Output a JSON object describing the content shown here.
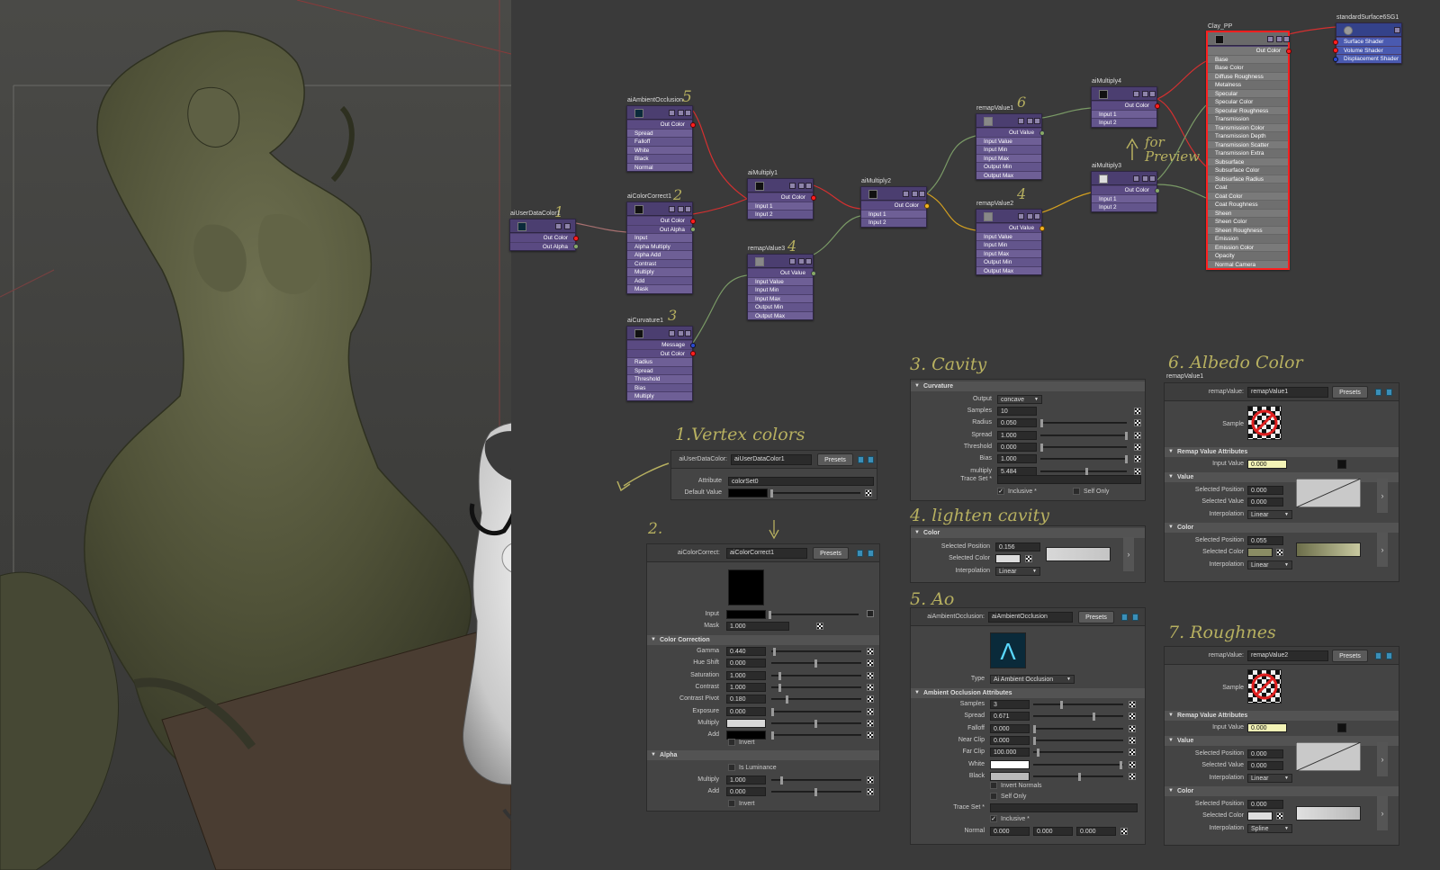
{
  "nodes": {
    "ao": {
      "title": "aiAmbientOcclusion",
      "out": "Out Color",
      "inputs": [
        "Spread",
        "Falloff",
        "White",
        "Black",
        "Normal"
      ]
    },
    "ud": {
      "title": "aiUserDataColor1",
      "outs": [
        "Out Color",
        "Out Alpha"
      ]
    },
    "cc": {
      "title": "aiColorCorrect1",
      "outs": [
        "Out Color",
        "Out Alpha"
      ],
      "inputs": [
        "Input",
        "Alpha Multiply",
        "Alpha Add",
        "Contrast",
        "Multiply",
        "Add",
        "Mask"
      ]
    },
    "curv": {
      "title": "aiCurvature1",
      "outs": [
        "Message",
        "Out Color"
      ],
      "inputs": [
        "Radius",
        "Spread",
        "Threshold",
        "Bias",
        "Multiply"
      ]
    },
    "m1": {
      "title": "aiMultiply1",
      "out": "Out Color",
      "inputs": [
        "Input 1",
        "Input 2"
      ]
    },
    "rv3": {
      "title": "remapValue3",
      "out": "Out Value",
      "inputs": [
        "Input Value",
        "Input Min",
        "Input Max",
        "Output Min",
        "Output Max"
      ]
    },
    "m2": {
      "title": "aiMultiply2",
      "out": "Out Color",
      "inputs": [
        "Input 1",
        "Input 2"
      ]
    },
    "rv1": {
      "title": "remapValue1",
      "out": "Out Value",
      "inputs": [
        "Input Value",
        "Input Min",
        "Input Max",
        "Output Min",
        "Output Max"
      ]
    },
    "rv2": {
      "title": "remapValue2",
      "out": "Out Value",
      "inputs": [
        "Input Value",
        "Input Min",
        "Input Max",
        "Output Min",
        "Output Max"
      ]
    },
    "m4": {
      "title": "aiMultiply4",
      "out": "Out Color",
      "inputs": [
        "Input 1",
        "Input 2"
      ]
    },
    "m3": {
      "title": "aiMultiply3",
      "out": "Out Color",
      "inputs": [
        "Input 1",
        "Input 2"
      ]
    },
    "clay": {
      "title": "Clay_PP",
      "out": "Out Color",
      "inputs": [
        "Base",
        "Base Color",
        "Diffuse Roughness",
        "Metalness",
        "Specular",
        "Specular Color",
        "Specular Roughness",
        "Transmission",
        "Transmission Color",
        "Transmission Depth",
        "Transmission Scatter",
        "Transmission Extra Roughness",
        "Subsurface",
        "Subsurface Color",
        "Subsurface Radius",
        "Coat",
        "Coat Color",
        "Coat Roughness",
        "Sheen",
        "Sheen Color",
        "Sheen Roughness",
        "Emission",
        "Emission Color",
        "Opacity",
        "Normal Camera"
      ]
    },
    "sg": {
      "title": "standardSurface6SG1",
      "inputs": [
        "Surface Shader",
        "Volume Shader",
        "Displacement Shader"
      ]
    }
  },
  "annotations": {
    "n5": "5",
    "n2": "2",
    "n1": "1",
    "n3": "3",
    "n4": "4",
    "n6": "6",
    "n4b": "4",
    "forpreview": "for Preview",
    "h1": "1.Vertex colors",
    "h2": "2.",
    "h3": "3. Cavity",
    "h4": "4. lighten cavity",
    "h5": "5. Ao",
    "h6": "6. Albedo Color",
    "h7": "7. Roughnes"
  },
  "p1": {
    "nodeLabel": "aiUserDataColor:",
    "nodeName": "aiUserDataColor1",
    "presets": "Presets",
    "attrLabel": "Attribute",
    "attr": "colorSet0",
    "defLabel": "Default Value"
  },
  "p2": {
    "nodeLabel": "aiColorCorrect:",
    "nodeName": "aiColorCorrect1",
    "presets": "Presets",
    "input": "Input",
    "maskLabel": "Mask",
    "mask": "1.000",
    "sec1": "Color Correction",
    "rows": [
      {
        "l": "Gamma",
        "v": "0.440"
      },
      {
        "l": "Hue Shift",
        "v": "0.000"
      },
      {
        "l": "Saturation",
        "v": "1.000"
      },
      {
        "l": "Contrast",
        "v": "1.000"
      },
      {
        "l": "Contrast Pivot",
        "v": "0.180"
      },
      {
        "l": "Exposure",
        "v": "0.000"
      },
      {
        "l": "Multiply",
        "v": ""
      },
      {
        "l": "Add",
        "v": ""
      }
    ],
    "invert": "Invert",
    "sec2": "Alpha",
    "isLum": "Is Luminance",
    "mulLabel": "Multiply",
    "mul": "1.000",
    "addLabel": "Add",
    "add": "0.000",
    "invert2": "Invert"
  },
  "p3": {
    "sec": "Curvature",
    "outLabel": "Output",
    "output": "concave",
    "rows": [
      {
        "l": "Samples",
        "v": "10"
      },
      {
        "l": "Radius",
        "v": "0.050"
      },
      {
        "l": "Spread",
        "v": "1.000"
      },
      {
        "l": "Threshold",
        "v": "0.000"
      },
      {
        "l": "Bias",
        "v": "1.000"
      },
      {
        "l": "multiply",
        "v": "5.484"
      }
    ],
    "trace": "Trace Set *",
    "inclusive": "Inclusive *",
    "selfOnly": "Self Only"
  },
  "p4": {
    "sec": "Color",
    "posLabel": "Selected Position",
    "pos": "0.156",
    "colLabel": "Selected Color",
    "interpLabel": "Interpolation",
    "interp": "Linear"
  },
  "p5": {
    "nodeLabel": "aiAmbientOcclusion:",
    "nodeName": "aiAmbientOcclusion",
    "presets": "Presets",
    "typeLabel": "Type",
    "type": "Ai Ambient Occlusion",
    "sec": "Ambient Occlusion Attributes",
    "rows": [
      {
        "l": "Samples",
        "v": "3"
      },
      {
        "l": "Spread",
        "v": "0.671"
      },
      {
        "l": "Falloff",
        "v": "0.000"
      },
      {
        "l": "Near Clip",
        "v": "0.000"
      },
      {
        "l": "Far Clip",
        "v": "100.000"
      },
      {
        "l": "White",
        "v": ""
      },
      {
        "l": "Black",
        "v": ""
      }
    ],
    "invNormals": "Invert Normals",
    "selfOnly": "Self Only",
    "trace": "Trace Set *",
    "inclusive": "Inclusive *",
    "normalLabel": "Normal",
    "n1": "0.000",
    "n2": "0.000",
    "n3": "0.000"
  },
  "p6": {
    "title": "remapValue1",
    "nodeLabel": "remapValue:",
    "nodeName": "remapValue1",
    "presets": "Presets",
    "sample": "Sample",
    "secRemap": "Remap Value Attributes",
    "ivLabel": "Input Value",
    "iv": "0.000",
    "secValue": "Value",
    "spLabel": "Selected Position",
    "sp": "0.000",
    "svLabel": "Selected Value",
    "sv": "0.000",
    "interpLabel": "Interpolation",
    "interp": "Linear",
    "secColor": "Color",
    "cpLabel": "Selected Position",
    "cp": "0.055",
    "ccLabel": "Selected Color",
    "ciLabel": "Interpolation",
    "ci": "Linear"
  },
  "p7": {
    "nodeLabel": "remapValue:",
    "nodeName": "remapValue2",
    "presets": "Presets",
    "sample": "Sample",
    "secRemap": "Remap Value Attributes",
    "ivLabel": "Input Value",
    "iv": "0.000",
    "secValue": "Value",
    "spLabel": "Selected Position",
    "sp": "0.000",
    "svLabel": "Selected Value",
    "sv": "0.000",
    "interpLabel": "Interpolation",
    "interp": "Linear",
    "secColor": "Color",
    "cpLabel": "Selected Position",
    "cp": "0.000",
    "ccLabel": "Selected Color",
    "ciLabel": "Interpolation",
    "ci": "Spline"
  }
}
